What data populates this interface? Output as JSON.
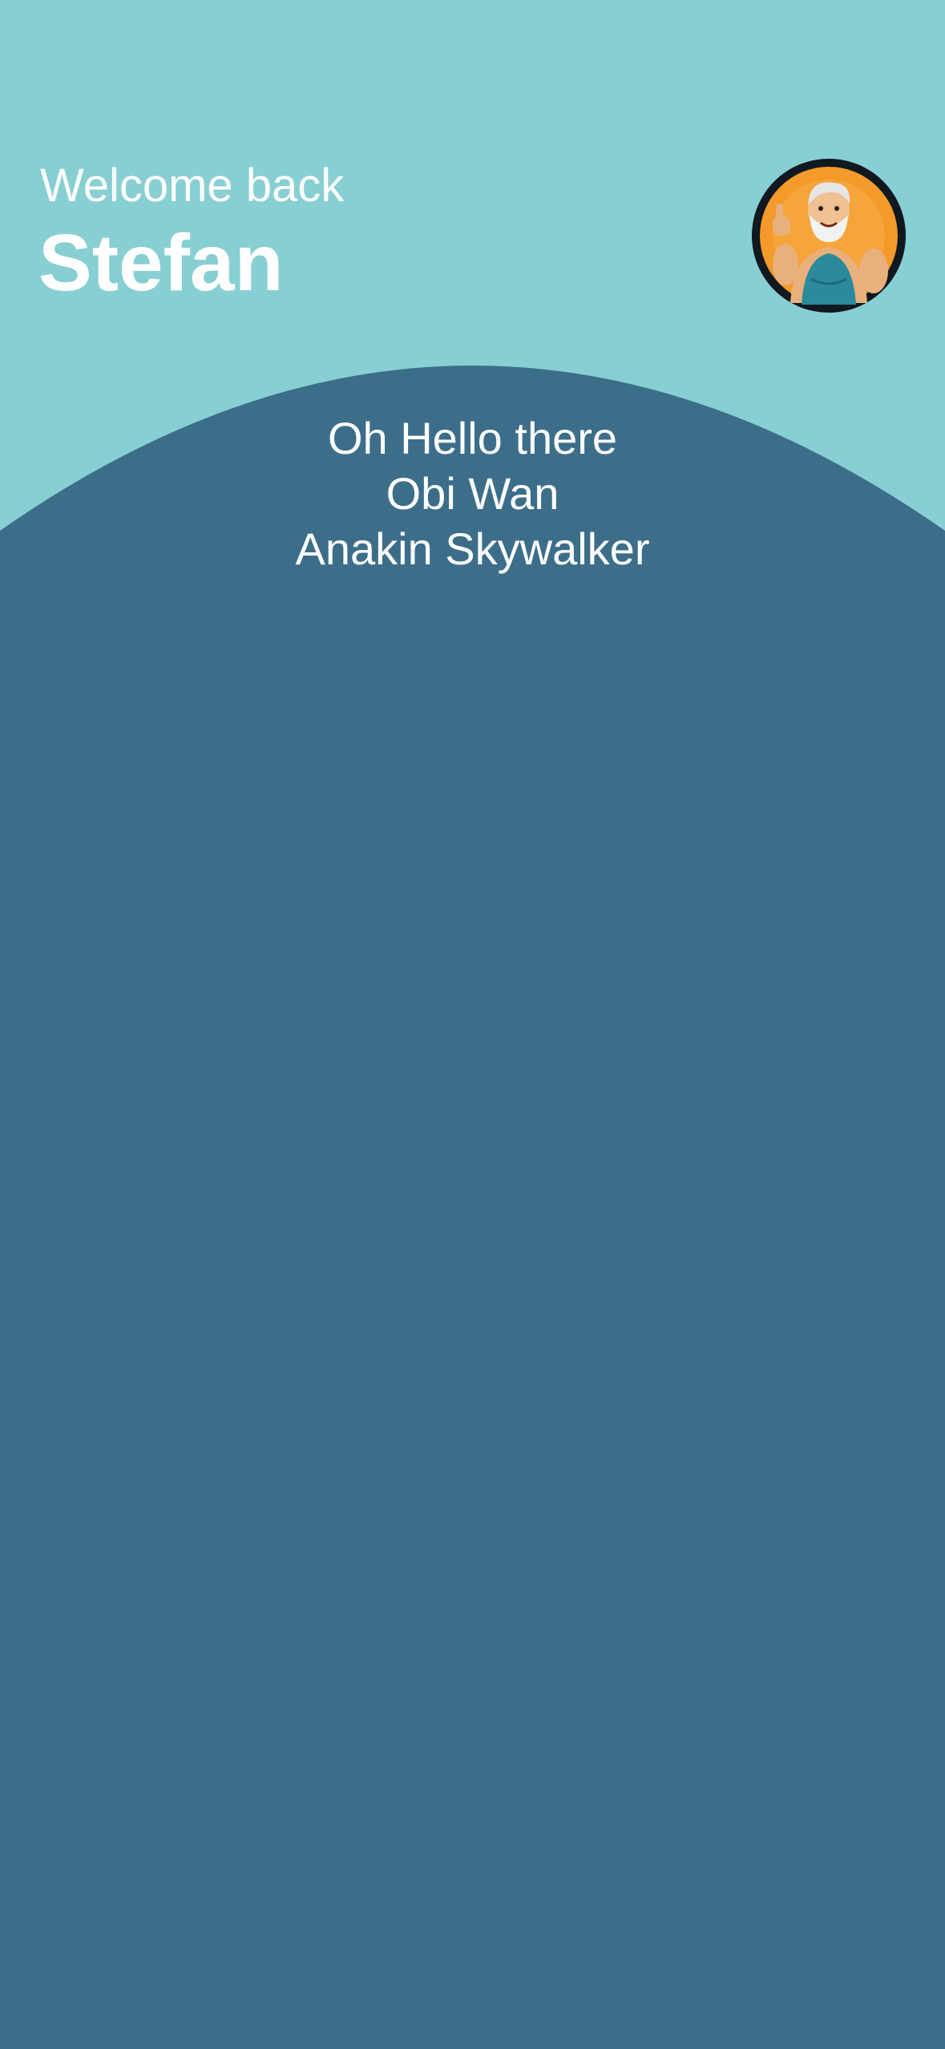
{
  "greeting": {
    "subtitle": "Welcome back",
    "name": "Stefan"
  },
  "avatar": {
    "icon": "cartoon-bodybuilder-avatar-icon"
  },
  "message": {
    "lines": [
      "Oh Hello there",
      "Obi Wan",
      "Anakin Skywalker"
    ]
  },
  "colors": {
    "header_background": "#88CFD3",
    "panel_background": "#3C6E8A",
    "text": "#FFFFFF",
    "avatar_ring": "#101820",
    "avatar_background": "#F39A2A"
  }
}
